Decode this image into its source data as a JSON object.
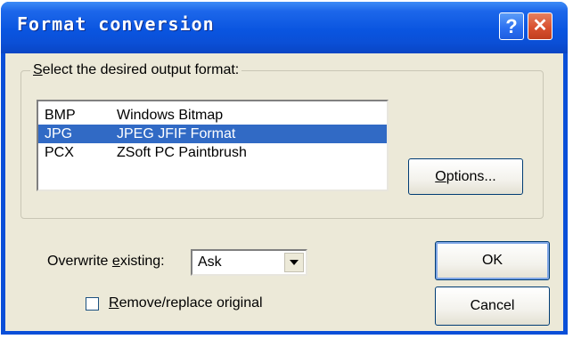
{
  "window": {
    "title": "Format conversion",
    "help_glyph": "?",
    "close_glyph": "✕"
  },
  "group": {
    "label_prefix": "",
    "label_mnemonic": "S",
    "label_rest": "elect the desired output format:"
  },
  "formats": [
    {
      "ext": "BMP",
      "name": "Windows Bitmap",
      "selected": false
    },
    {
      "ext": "JPG",
      "name": "JPEG JFIF Format",
      "selected": true
    },
    {
      "ext": "PCX",
      "name": "ZSoft PC Paintbrush",
      "selected": false
    }
  ],
  "options_button": {
    "mnemonic": "O",
    "rest": "ptions..."
  },
  "overwrite": {
    "label_prefix": "Overwrite ",
    "label_mnemonic": "e",
    "label_rest": "xisting:",
    "value": "Ask"
  },
  "remove_original": {
    "checked": false,
    "label_mnemonic": "R",
    "label_rest": "emove/replace original"
  },
  "ok_button": {
    "label": "OK"
  },
  "cancel_button": {
    "label": "Cancel"
  },
  "colors": {
    "titlebar": "#0a55e0",
    "dialog_face": "#ece9d8",
    "selection": "#316ac5",
    "close_button": "#d9512f"
  },
  "icons": {
    "help": "help-icon",
    "close": "close-icon",
    "dropdown": "chevron-down-icon"
  }
}
